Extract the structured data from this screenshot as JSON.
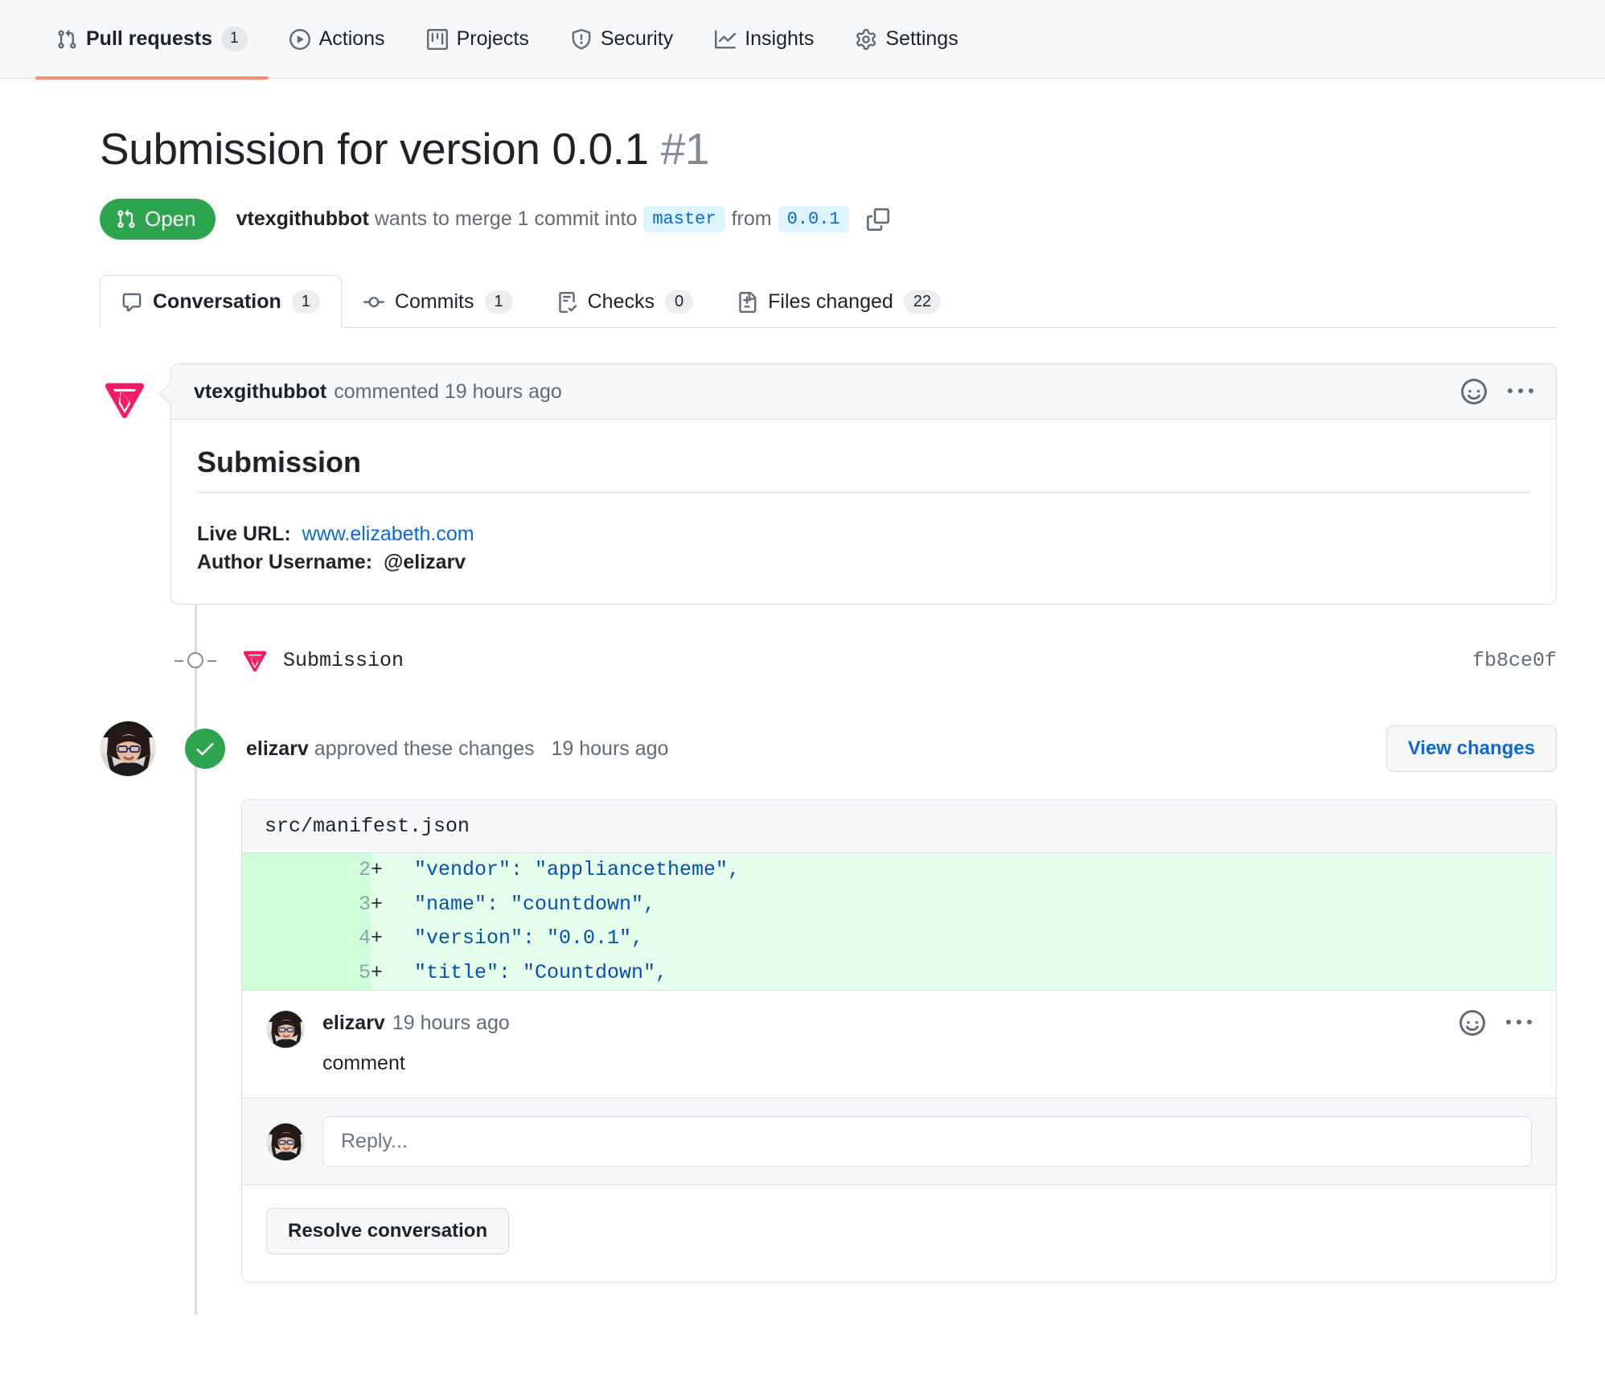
{
  "repo_nav": {
    "items": [
      {
        "label": "Pull requests",
        "icon": "pull-request-icon",
        "count": "1",
        "selected": true
      },
      {
        "label": "Actions",
        "icon": "play-circle-icon",
        "count": null,
        "selected": false
      },
      {
        "label": "Projects",
        "icon": "project-board-icon",
        "count": null,
        "selected": false
      },
      {
        "label": "Security",
        "icon": "shield-alert-icon",
        "count": null,
        "selected": false
      },
      {
        "label": "Insights",
        "icon": "graph-icon",
        "count": null,
        "selected": false
      },
      {
        "label": "Settings",
        "icon": "gear-icon",
        "count": null,
        "selected": false
      }
    ]
  },
  "pr": {
    "title": "Submission for version 0.0.1",
    "number": "#1",
    "state_label": "Open",
    "state_color": "#2DA44E",
    "author": "vtexgithubbot",
    "merge_text_1": "wants to merge 1 commit into",
    "base_branch": "master",
    "merge_text_2": "from",
    "head_branch": "0.0.1",
    "copy_icon": "copy-icon"
  },
  "tabs": [
    {
      "label": "Conversation",
      "icon": "comment-icon",
      "count": "1",
      "active": true
    },
    {
      "label": "Commits",
      "icon": "commit-icon",
      "count": "1",
      "active": false
    },
    {
      "label": "Checks",
      "icon": "checklist-icon",
      "count": "0",
      "active": false
    },
    {
      "label": "Files changed",
      "icon": "file-diff-icon",
      "count": "22",
      "active": false
    }
  ],
  "comment": {
    "avatar": "vtex-logo-avatar",
    "author": "vtexgithubbot",
    "action": "commented",
    "timestamp": "19 hours ago",
    "reaction_icon": "smiley-icon",
    "menu_icon": "kebab-menu-icon",
    "heading": "Submission",
    "live_url_label": "Live URL:",
    "live_url": "www.elizabeth.com",
    "author_username_label": "Author Username:",
    "author_username": "@elizarv"
  },
  "commit": {
    "icon": "vtex-logo-icon",
    "message": "Submission",
    "sha": "fb8ce0f"
  },
  "review": {
    "avatar": "elizarv-avatar",
    "status_icon": "check-circle-icon",
    "reviewer": "elizarv",
    "text": "approved these changes",
    "timestamp": "19 hours ago",
    "view_changes_label": "View changes"
  },
  "diff": {
    "filename": "src/manifest.json",
    "lines": [
      {
        "num": "2",
        "sign": "+",
        "code": "\"vendor\": \"appliancetheme\","
      },
      {
        "num": "3",
        "sign": "+",
        "code": "\"name\": \"countdown\","
      },
      {
        "num": "4",
        "sign": "+",
        "code": "\"version\": \"0.0.1\","
      },
      {
        "num": "5",
        "sign": "+",
        "code": "\"title\": \"Countdown\","
      }
    ]
  },
  "thread_comment": {
    "avatar": "elizarv-avatar",
    "author": "elizarv",
    "timestamp": "19 hours ago",
    "body": "comment",
    "reaction_icon": "smiley-icon",
    "menu_icon": "kebab-menu-icon"
  },
  "reply": {
    "avatar": "elizarv-avatar",
    "placeholder": "Reply...",
    "value": ""
  },
  "resolve": {
    "label": "Resolve conversation"
  }
}
